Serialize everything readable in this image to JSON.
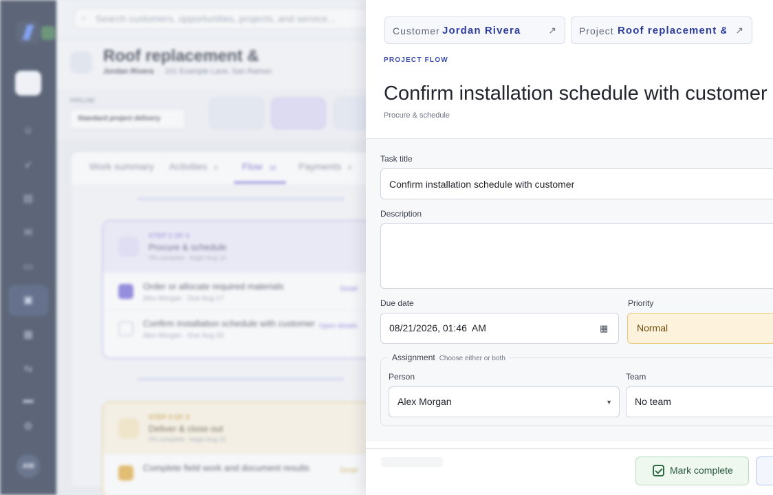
{
  "background": {
    "search_placeholder": "Search customers, opportunities, projects, and service...",
    "project_title": "Roof replacement &",
    "project_customer": "Jordan Rivera",
    "project_address": "101 Example Lane, San Ramon",
    "pipeline_label": "PIPELINE",
    "pipeline_value": "Standard project delivery",
    "tabs": [
      {
        "label": "Work summary"
      },
      {
        "label": "Activities",
        "count": "4"
      },
      {
        "label": "Flow",
        "count": "16"
      },
      {
        "label": "Payments",
        "count": "0"
      }
    ],
    "step2": {
      "step": "STEP 2 OF 3",
      "title": "Procure & schedule",
      "meta": "0% complete · begin Aug 14",
      "tasks": [
        {
          "name": "Order or allocate required materials",
          "meta": "Alex Morgan · Due Aug 17",
          "action": "Detail"
        },
        {
          "name": "Confirm installation schedule with customer",
          "meta": "Alex Morgan · Due Aug 20",
          "action": "Open details"
        }
      ]
    },
    "step3": {
      "step": "STEP 3 OF 3",
      "title": "Deliver & close out",
      "meta": "0% complete · begin Aug 21",
      "tasks": [
        {
          "name": "Complete field work and document results",
          "action": "Detail"
        }
      ]
    },
    "user_initials": "AM"
  },
  "drawer": {
    "customer_chip": {
      "label": "Customer",
      "value": "Jordan Rivera"
    },
    "project_chip": {
      "label": "Project",
      "value": "Roof replacement &"
    },
    "flow_label": "PROJECT FLOW",
    "title": "Confirm installation schedule with customer",
    "subtitle": "Procure & schedule",
    "form": {
      "task_title_label": "Task title",
      "task_title_value": "Confirm installation schedule with customer",
      "description_label": "Description",
      "description_value": "",
      "due_date_label": "Due date",
      "due_date_value": "08/21/2026, 01:46  AM",
      "priority_label": "Priority",
      "priority_value": "Normal",
      "assignment_label": "Assignment",
      "assignment_hint": "Choose either or both",
      "person_label": "Person",
      "person_value": "Alex Morgan",
      "team_label": "Team",
      "team_value": "No team"
    },
    "footer": {
      "mark_complete_label": "Mark complete"
    }
  },
  "colors": {
    "accent": "#2c3e9a",
    "sidebar": "#14213a",
    "priority_bg": "#fdf3dc",
    "complete_bg": "#eef8ef"
  },
  "icons": [
    "search-icon",
    "external-link-icon",
    "calendar-icon",
    "chevron-down-icon",
    "checkbox-check-icon"
  ]
}
